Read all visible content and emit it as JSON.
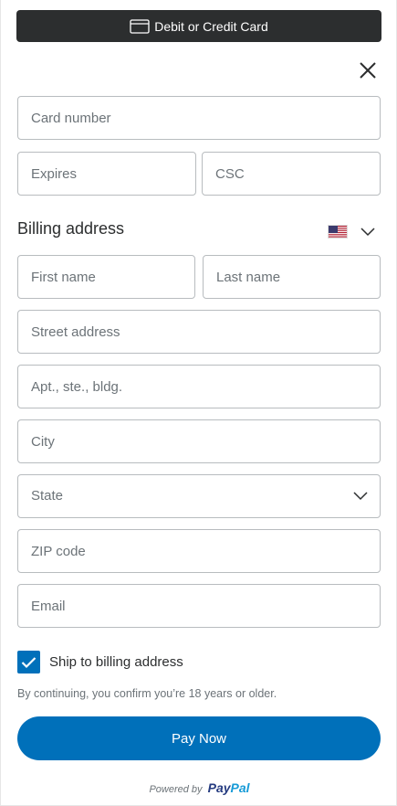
{
  "header": {
    "card_button_label": "Debit or Credit Card"
  },
  "card": {
    "number_placeholder": "Card number",
    "expires_placeholder": "Expires",
    "csc_placeholder": "CSC"
  },
  "billing": {
    "title": "Billing address",
    "country_flag": "us-flag-icon",
    "first_name_placeholder": "First name",
    "last_name_placeholder": "Last name",
    "street_placeholder": "Street address",
    "apt_placeholder": "Apt., ste., bldg.",
    "city_placeholder": "City",
    "state_selected": "State",
    "zip_placeholder": "ZIP code",
    "email_placeholder": "Email"
  },
  "ship": {
    "label": "Ship to billing address",
    "checked": true
  },
  "disclaimer": "By continuing, you confirm you’re 18 years or older.",
  "pay_button_label": "Pay Now",
  "footer": {
    "powered_by": "Powered by",
    "logo_pay": "Pay",
    "logo_pal": "Pal"
  },
  "colors": {
    "primary": "#0070ba",
    "dark_button": "#2c2e2f",
    "border": "#b8bcbf",
    "muted_text": "#6c7378"
  }
}
